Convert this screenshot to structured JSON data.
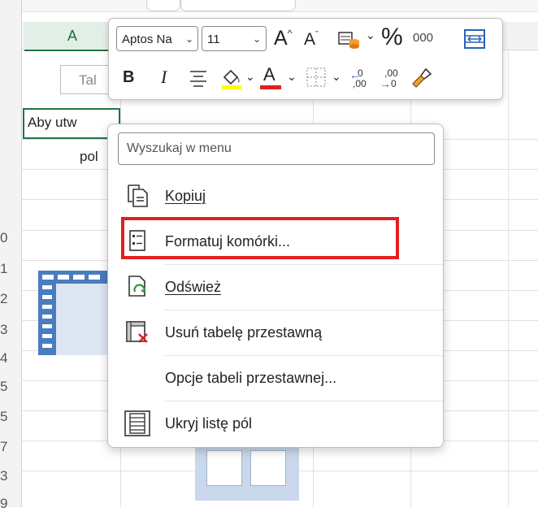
{
  "sheet": {
    "column_a": "A",
    "row_numbers": [
      "0",
      "1",
      "2",
      "3",
      "4",
      "5",
      "5",
      "7",
      "3",
      "9"
    ],
    "tab_placeholder": "Tal",
    "cell_text_line1": "Aby utw",
    "cell_text_line2": "pol"
  },
  "toolbar": {
    "font_name": "Aptos Na",
    "font_size": "11",
    "increase_font": "A",
    "decrease_font": "A",
    "percent": "%",
    "comma_style": "000",
    "bold": "B",
    "italic": "I",
    "font_color_letter": "A",
    "increase_decimal": ",00",
    "decrease_decimal": ",00",
    "colors": {
      "highlight": "#ffff00",
      "font_color": "#e02020"
    }
  },
  "menu": {
    "search_placeholder": "Wyszukaj w menu",
    "items": [
      {
        "label": "Kopiuj",
        "icon": "copy-icon"
      },
      {
        "label": "Formatuj komórki...",
        "icon": "format-cells-icon"
      },
      {
        "label": "Odśwież",
        "icon": "refresh-icon"
      },
      {
        "label": "Usuń tabelę przestawną",
        "icon": "delete-pivot-icon"
      },
      {
        "label": "Opcje tabeli przestawnej...",
        "icon": ""
      },
      {
        "label": "Ukryj listę pól",
        "icon": "field-list-icon"
      }
    ],
    "highlight_color": "#e02020"
  }
}
